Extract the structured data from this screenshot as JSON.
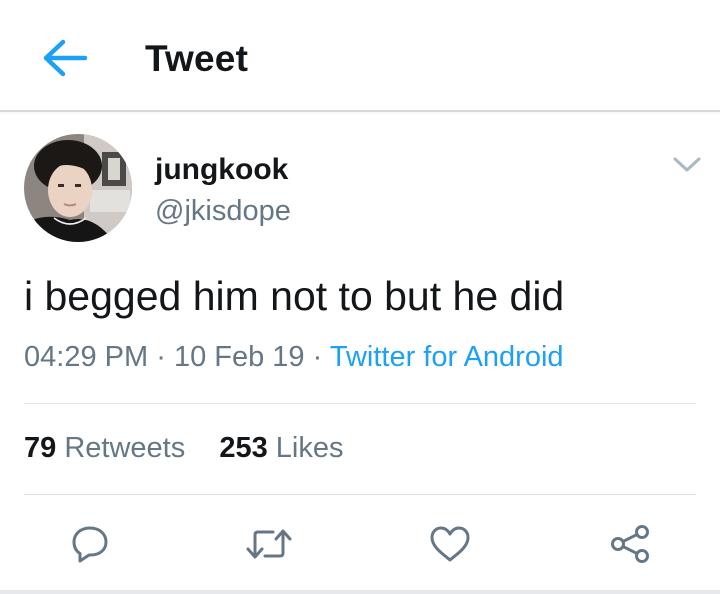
{
  "header": {
    "back_icon": "arrow-left-icon",
    "title": "Tweet"
  },
  "author": {
    "name": "jungkook",
    "handle": "@jkisdope",
    "menu_icon": "chevron-down-icon"
  },
  "tweet": {
    "text": "i begged him not to but he did",
    "time": "04:29 PM",
    "date": "10 Feb 19",
    "separator": "·",
    "source": "Twitter for Android"
  },
  "stats": {
    "retweets_count": "79",
    "retweets_label": "Retweets",
    "likes_count": "253",
    "likes_label": "Likes"
  },
  "actions": [
    {
      "name": "reply",
      "icon": "reply-icon"
    },
    {
      "name": "retweet",
      "icon": "retweet-icon"
    },
    {
      "name": "like",
      "icon": "heart-icon"
    },
    {
      "name": "share",
      "icon": "share-icon"
    }
  ],
  "colors": {
    "accent": "#1da1f2",
    "text_primary": "#14171a",
    "text_secondary": "#657786",
    "divider": "#dfe3e6"
  }
}
